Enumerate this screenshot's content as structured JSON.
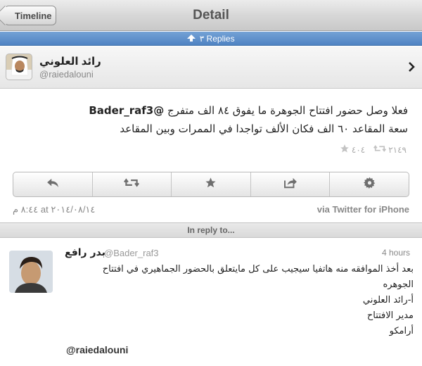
{
  "nav": {
    "back_label": "Timeline",
    "title": "Detail"
  },
  "replies_bar": {
    "label": "٣ Replies"
  },
  "author": {
    "name": "رائد العلوني",
    "handle": "@raiedalouni"
  },
  "tweet": {
    "line1_text": "فعلا وصل حضور افتتاح الجوهرة ما يفوق ٨٤ الف متفرج ",
    "mention": "@Bader_raf3",
    "line2_text": "سعة المقاعد ٦٠ الف فكان الألف  تواجدا في الممرات وبين المقاعد",
    "retweet_count": "٢١٤٩",
    "favorite_count": "٤٠٤"
  },
  "actions": [
    {
      "name": "reply",
      "icon": "reply-icon"
    },
    {
      "name": "retweet",
      "icon": "retweet-icon"
    },
    {
      "name": "favorite",
      "icon": "star-icon"
    },
    {
      "name": "share",
      "icon": "share-icon"
    },
    {
      "name": "more",
      "icon": "gear-icon"
    }
  ],
  "meta": {
    "timestamp": "٨:٤٤ م at ٢٠١٤/٠٨/١٤",
    "source": "via Twitter for iPhone"
  },
  "in_reply_to": {
    "label": "In reply to..."
  },
  "reply": {
    "name": "بدر رافع",
    "handle": "@Bader_raf3",
    "time": "4 hours",
    "line1": "بعد أخذ الموافقه منه هاتفيا سيجيب على كل مايتعلق بالحضور الجماهيري في افتتاح",
    "line2": "الجوهره",
    "line3": "أ-رائد العلوني",
    "line4": "مدير الافتتاح",
    "line5": "أرامكو",
    "mention": "@raiedalouni"
  },
  "colors": {
    "replies_bar": "#5a8cc8",
    "navbar": "#d4d4d4"
  }
}
